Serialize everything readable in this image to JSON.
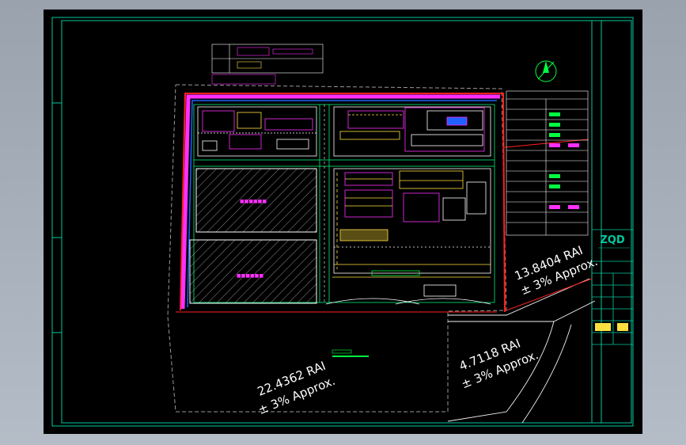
{
  "drawing": {
    "logo": "ZQD",
    "colors": {
      "frame": "#00c8a0",
      "boundary_red": "#ff2020",
      "boundary_magenta": "#ff30ff",
      "boundary_blue": "#2060ff",
      "annotation": "#ffffff",
      "road": "#f0f0f0",
      "accent_yellow": "#ffe040",
      "accent_green": "#00ff40"
    }
  },
  "parcels": {
    "north_east": {
      "value": "13.8404 RAI",
      "tolerance": "± 3% Approx."
    },
    "south_west": {
      "value": "22.4362 RAI",
      "tolerance": "± 3% Approx."
    },
    "south_east": {
      "value": "4.7118 RAI",
      "tolerance": "± 3% Approx."
    }
  }
}
